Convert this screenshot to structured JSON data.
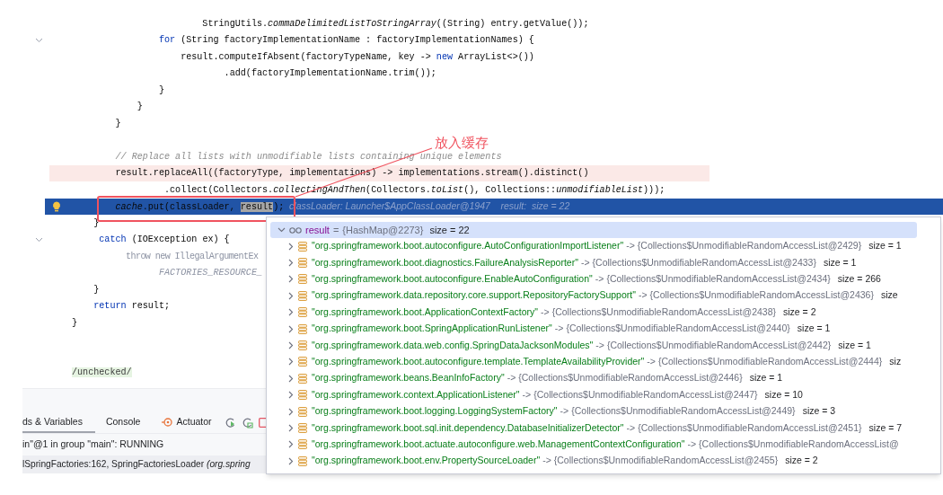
{
  "editor": {
    "lines": [
      {
        "modified": false,
        "current": false,
        "fold": false,
        "tokens": [
          {
            "kind": "plain",
            "text": "                        StringUtils."
          },
          {
            "kind": "italic",
            "text": "commaDelimitedListToStringArray"
          },
          {
            "kind": "plain",
            "text": "((String) entry.getValue());"
          }
        ]
      },
      {
        "modified": false,
        "current": false,
        "fold": true,
        "tokens": [
          {
            "kind": "keyword",
            "text": "                for"
          },
          {
            "kind": "plain",
            "text": " (String factoryImplementationName : factoryImplementationNames) {"
          }
        ]
      },
      {
        "modified": false,
        "current": false,
        "fold": false,
        "tokens": [
          {
            "kind": "usage",
            "text": "                    result"
          },
          {
            "kind": "plain",
            "text": ".computeIfAbsent(factoryTypeName, key -> "
          },
          {
            "kind": "keyword",
            "text": "new"
          },
          {
            "kind": "plain",
            "text": " ArrayList<>())"
          }
        ]
      },
      {
        "modified": false,
        "current": false,
        "fold": false,
        "tokens": [
          {
            "kind": "plain",
            "text": "                            .add(factoryImplementationName.trim());"
          }
        ]
      },
      {
        "modified": false,
        "current": false,
        "fold": false,
        "tokens": [
          {
            "kind": "plain",
            "text": "                }"
          }
        ]
      },
      {
        "modified": false,
        "current": false,
        "fold": false,
        "tokens": [
          {
            "kind": "plain",
            "text": "            }"
          }
        ]
      },
      {
        "modified": false,
        "current": false,
        "fold": false,
        "tokens": [
          {
            "kind": "plain",
            "text": "        }"
          }
        ]
      },
      {
        "modified": false,
        "current": false,
        "fold": false
      },
      {
        "modified": false,
        "current": false,
        "fold": false,
        "tokens": [
          {
            "kind": "comment",
            "text": "        // Replace all lists with unmodifiable lists containing unique elements"
          }
        ]
      },
      {
        "modified": true,
        "current": false,
        "fold": false,
        "tokens": [
          {
            "kind": "plain",
            "text": "        result.replaceAll((factoryType, implementations) -> implementations.stream().distinct()"
          }
        ]
      },
      {
        "modified": false,
        "current": false,
        "fold": false,
        "tokens": [
          {
            "kind": "plain",
            "text": "                 .collect(Collectors."
          },
          {
            "kind": "italic",
            "text": "collectingAndThen"
          },
          {
            "kind": "plain",
            "text": "(Collectors."
          },
          {
            "kind": "italic",
            "text": "toList"
          },
          {
            "kind": "plain",
            "text": "(), Collections::"
          },
          {
            "kind": "italic",
            "text": "unmodifiableList"
          },
          {
            "kind": "plain",
            "text": ")));"
          }
        ]
      },
      {
        "modified": false,
        "current": true,
        "fold": false,
        "tokens": [
          {
            "kind": "italic",
            "text": "        cache"
          },
          {
            "kind": "plain",
            "text": ".put(classLoader, "
          },
          {
            "kind": "selected",
            "text": "result"
          },
          {
            "kind": "plain",
            "text": ");"
          },
          {
            "kind": "hint",
            "text": "  classLoader: Launcher$AppClassLoader@1947    result:  size = 22"
          }
        ]
      },
      {
        "modified": false,
        "current": false,
        "fold": false,
        "tokens": [
          {
            "kind": "plain",
            "text": "    }"
          }
        ]
      },
      {
        "modified": false,
        "current": false,
        "fold": true,
        "tokens": [
          {
            "kind": "keyword",
            "text": "     catch"
          },
          {
            "kind": "plain",
            "text": " (IOException ex) {"
          }
        ]
      },
      {
        "modified": false,
        "current": false,
        "fold": false,
        "tokens": [
          {
            "kind": "muted",
            "text": "           throw new IllegalArgumentEx"
          }
        ]
      },
      {
        "modified": false,
        "current": false,
        "fold": false,
        "tokens": [
          {
            "kind": "muted-italic",
            "text": "                FACTORIES_RESOURCE_"
          }
        ]
      },
      {
        "modified": false,
        "current": false,
        "fold": false,
        "tokens": [
          {
            "kind": "plain",
            "text": "    }"
          }
        ]
      },
      {
        "modified": false,
        "current": false,
        "fold": false,
        "tokens": [
          {
            "kind": "keyword",
            "text": "    return"
          },
          {
            "kind": "usage",
            "text": " result"
          },
          {
            "kind": "plain",
            "text": ";"
          }
        ]
      },
      {
        "modified": false,
        "current": false,
        "fold": false,
        "tokens": [
          {
            "kind": "plain",
            "text": "}"
          }
        ]
      },
      {
        "modified": false,
        "current": false,
        "fold": false
      },
      {
        "modified": false,
        "current": false,
        "fold": false
      },
      {
        "modified": false,
        "current": false,
        "fold": false,
        "tokens": [
          {
            "kind": "suppress",
            "text": "/unchecked/"
          }
        ]
      }
    ]
  },
  "annotation": {
    "text": "放入缓存"
  },
  "debugger": {
    "tabs": [
      {
        "label": "ds & Variables",
        "selected": true
      },
      {
        "label": "Console",
        "selected": false
      },
      {
        "label": "Actuator",
        "selected": false
      }
    ],
    "thread_status": "in\"@1 in group \"main\": RUNNING",
    "frame": {
      "method": "lSpringFactories:162, SpringFactoriesLoader ",
      "package": "(org.spring"
    }
  },
  "variables": {
    "root": {
      "name": "result",
      "separator": "=",
      "value": "{HashMap@2273}",
      "size": "size = 22",
      "expanded": true,
      "selected": true,
      "children": [
        {
          "key": "\"org.springframework.boot.autoconfigure.AutoConfigurationImportListener\"",
          "arrow": "->",
          "value": "{Collections$UnmodifiableRandomAccessList@2429}",
          "size": "size = 1"
        },
        {
          "key": "\"org.springframework.boot.diagnostics.FailureAnalysisReporter\"",
          "arrow": "->",
          "value": "{Collections$UnmodifiableRandomAccessList@2433}",
          "size": "size = 1"
        },
        {
          "key": "\"org.springframework.boot.autoconfigure.EnableAutoConfiguration\"",
          "arrow": "->",
          "value": "{Collections$UnmodifiableRandomAccessList@2434}",
          "size": "size = 266"
        },
        {
          "key": "\"org.springframework.data.repository.core.support.RepositoryFactorySupport\"",
          "arrow": "->",
          "value": "{Collections$UnmodifiableRandomAccessList@2436}",
          "size": "size"
        },
        {
          "key": "\"org.springframework.boot.ApplicationContextFactory\"",
          "arrow": "->",
          "value": "{Collections$UnmodifiableRandomAccessList@2438}",
          "size": "size = 2"
        },
        {
          "key": "\"org.springframework.boot.SpringApplicationRunListener\"",
          "arrow": "->",
          "value": "{Collections$UnmodifiableRandomAccessList@2440}",
          "size": "size = 1"
        },
        {
          "key": "\"org.springframework.data.web.config.SpringDataJacksonModules\"",
          "arrow": "->",
          "value": "{Collections$UnmodifiableRandomAccessList@2442}",
          "size": "size = 1"
        },
        {
          "key": "\"org.springframework.boot.autoconfigure.template.TemplateAvailabilityProvider\"",
          "arrow": "->",
          "value": "{Collections$UnmodifiableRandomAccessList@2444}",
          "size": "siz"
        },
        {
          "key": "\"org.springframework.beans.BeanInfoFactory\"",
          "arrow": "->",
          "value": "{Collections$UnmodifiableRandomAccessList@2446}",
          "size": "size = 1"
        },
        {
          "key": "\"org.springframework.context.ApplicationListener\"",
          "arrow": "->",
          "value": "{Collections$UnmodifiableRandomAccessList@2447}",
          "size": "size = 10"
        },
        {
          "key": "\"org.springframework.boot.logging.LoggingSystemFactory\"",
          "arrow": "->",
          "value": "{Collections$UnmodifiableRandomAccessList@2449}",
          "size": "size = 3"
        },
        {
          "key": "\"org.springframework.boot.sql.init.dependency.DatabaseInitializerDetector\"",
          "arrow": "->",
          "value": "{Collections$UnmodifiableRandomAccessList@2451}",
          "size": "size = 7"
        },
        {
          "key": "\"org.springframework.boot.actuate.autoconfigure.web.ManagementContextConfiguration\"",
          "arrow": "->",
          "value": "{Collections$UnmodifiableRandomAccessList@"
        },
        {
          "key": "\"org.springframework.boot.env.PropertySourceLoader\"",
          "arrow": "->",
          "value": "{Collections$UnmodifiableRandomAccessList@2455}",
          "size": "size = 2"
        }
      ]
    }
  }
}
